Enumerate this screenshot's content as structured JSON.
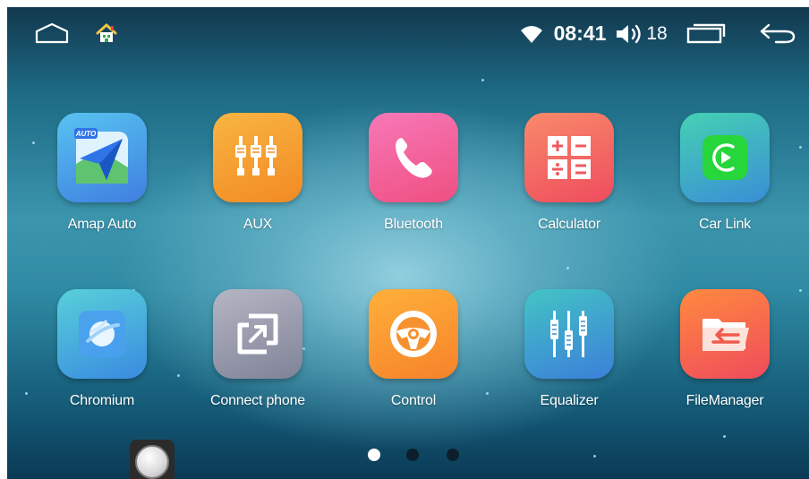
{
  "status_bar": {
    "time": "08:41",
    "volume_level": "18",
    "icons": [
      "home-outline-icon",
      "launcher-home-icon",
      "wifi-icon",
      "volume-icon",
      "recent-apps-icon",
      "back-arrow-icon"
    ]
  },
  "apps": [
    {
      "label": "Amap Auto",
      "icon": "amap-auto-icon",
      "badge": "AUTO",
      "color": "#3f7fe0"
    },
    {
      "label": "AUX",
      "icon": "aux-icon",
      "color": "#f39a2a"
    },
    {
      "label": "Bluetooth",
      "icon": "bluetooth-phone-icon",
      "color": "#f0568f"
    },
    {
      "label": "Calculator",
      "icon": "calculator-icon",
      "color": "#f05c5c"
    },
    {
      "label": "Car Link",
      "icon": "car-link-icon",
      "color": "#37b6c9"
    },
    {
      "label": "Chromium",
      "icon": "chromium-icon",
      "color": "#45b1d8"
    },
    {
      "label": "Connect phone",
      "icon": "connect-phone-icon",
      "color": "#8f93a6"
    },
    {
      "label": "Control",
      "icon": "steering-wheel-icon",
      "color": "#f7962d"
    },
    {
      "label": "Equalizer",
      "icon": "equalizer-icon",
      "color": "#3aa2c9"
    },
    {
      "label": "FileManager",
      "icon": "file-manager-icon",
      "color": "#f2663e"
    }
  ],
  "pager": {
    "total_pages": 3,
    "current_page": 1
  },
  "colors": {
    "dot_active": "#ffffff",
    "dot_inactive": "#0c1e2b"
  }
}
